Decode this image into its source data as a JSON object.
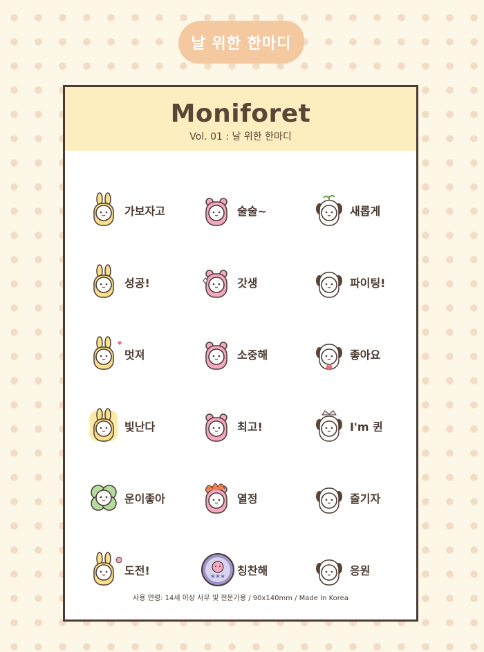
{
  "header": {
    "badge": "날 위한 한마디"
  },
  "card": {
    "title": "Moniforet",
    "subtitle": "Vol. 01 : 날 위한 한마디",
    "footer": "사용 연령: 14세 이상 사무 및 전문가용 / 90x140mm / Made In Korea"
  },
  "colors": {
    "background": "#fdf7e8",
    "dots": "#f3dcc4",
    "badge": "#f4c9a0",
    "card_header": "#fdeec0",
    "border": "#4b3a32",
    "yellow_character": "#f9e08c",
    "pink_character": "#f4a8c4",
    "clover": "#b5dba0"
  },
  "stickers": [
    {
      "label": "가보자고",
      "character": "yellow-bunny",
      "icon": "yellow-bunny-icon"
    },
    {
      "label": "술술~",
      "character": "pink-bear",
      "icon": "pink-bear-icon"
    },
    {
      "label": "새롭게",
      "character": "puppy",
      "icon": "puppy-sprout-icon"
    },
    {
      "label": "성공!",
      "character": "yellow-bunny",
      "icon": "yellow-bunny-icon"
    },
    {
      "label": "갓생",
      "character": "pink-bear",
      "icon": "pink-bear-sparkle-icon"
    },
    {
      "label": "파이팅!",
      "character": "puppy",
      "icon": "puppy-icon"
    },
    {
      "label": "멋져",
      "character": "yellow-bunny",
      "icon": "yellow-bunny-heart-icon"
    },
    {
      "label": "소중해",
      "character": "pink-bear",
      "icon": "pink-bear-icon"
    },
    {
      "label": "좋아요",
      "character": "puppy",
      "icon": "puppy-heart-icon"
    },
    {
      "label": "빛난다",
      "character": "yellow-bunny",
      "icon": "yellow-bunny-glow-icon"
    },
    {
      "label": "최고!",
      "character": "pink-bear",
      "icon": "pink-bear-icon"
    },
    {
      "label": "I'm 퀸",
      "character": "puppy",
      "icon": "puppy-crown-icon"
    },
    {
      "label": "운이좋아",
      "character": "clover",
      "icon": "clover-icon"
    },
    {
      "label": "열정",
      "character": "pink-bear",
      "icon": "pink-bear-fire-icon"
    },
    {
      "label": "즐기자",
      "character": "puppy",
      "icon": "puppy-icon"
    },
    {
      "label": "도전!",
      "character": "yellow-bunny",
      "icon": "yellow-bunny-flower-icon"
    },
    {
      "label": "칭찬해",
      "character": "badge",
      "icon": "star-badge-icon"
    },
    {
      "label": "응원",
      "character": "puppy",
      "icon": "puppy-icon"
    }
  ]
}
